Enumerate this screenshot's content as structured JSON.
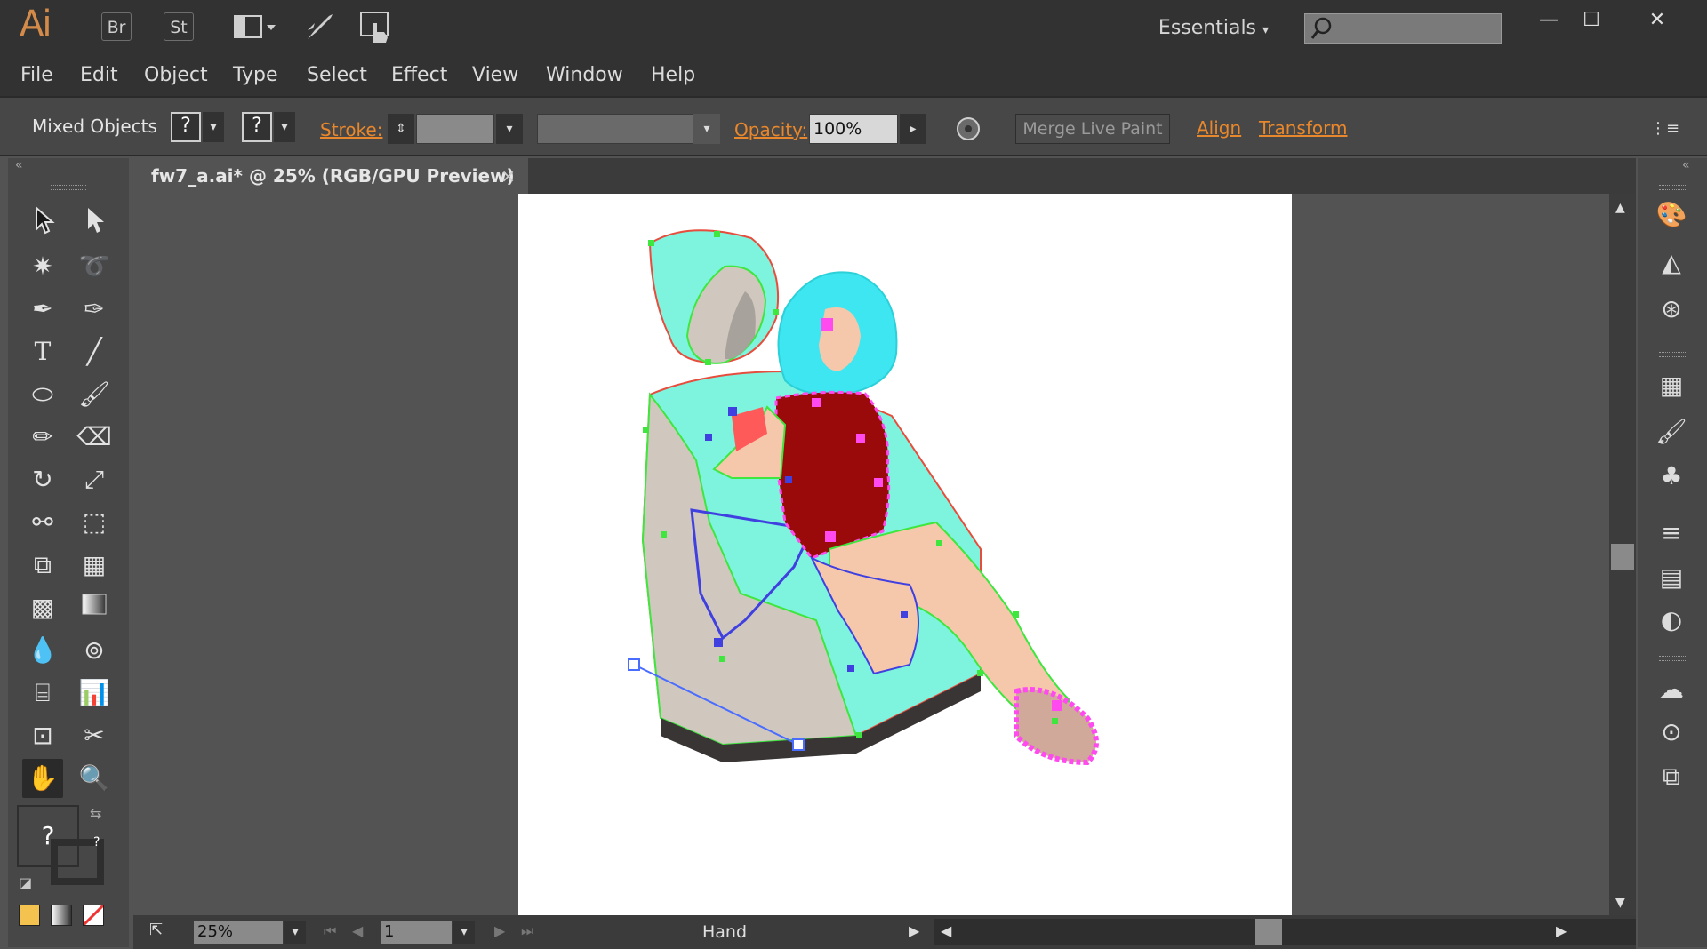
{
  "app": {
    "logo": "Ai",
    "bridge": "Br",
    "stock": "St",
    "workspace": "Essentials",
    "search_placeholder": ""
  },
  "window_controls": {
    "minimize": "—",
    "maximize": "☐",
    "close": "✕"
  },
  "menu": [
    "File",
    "Edit",
    "Object",
    "Type",
    "Select",
    "Effect",
    "View",
    "Window",
    "Help"
  ],
  "control": {
    "selection": "Mixed Objects",
    "fill_q": "?",
    "stroke_q": "?",
    "stroke_label": "Stroke:",
    "opacity_label": "Opacity:",
    "opacity_value": "100%",
    "merge": "Merge Live Paint",
    "align": "Align",
    "transform": "Transform"
  },
  "document": {
    "tab_title": "fw7_a.ai* @ 25% (RGB/GPU Preview)",
    "close": "×"
  },
  "status": {
    "zoom": "25%",
    "artboard": "1",
    "tool": "Hand"
  },
  "tools": {
    "question": "?",
    "small_q": "?"
  },
  "colors": {
    "accent": "#e8872b",
    "teal": "#7ef3dd",
    "beige": "#d0c8bf",
    "dark_red": "#9a0a0a",
    "skin": "#f5c8ab",
    "cyan_hair": "#3de6f0",
    "magenta": "#ff4af0"
  }
}
